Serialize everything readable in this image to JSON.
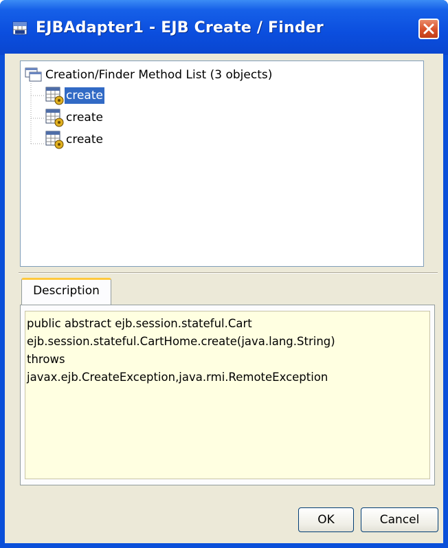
{
  "window": {
    "title": "EJBAdapter1 - EJB Create / Finder"
  },
  "tree": {
    "root_label": "Creation/Finder Method List (3 objects)",
    "items": [
      {
        "label": "create",
        "selected": true
      },
      {
        "label": "create",
        "selected": false
      },
      {
        "label": "create",
        "selected": false
      }
    ]
  },
  "description": {
    "tab_label": "Description",
    "lines": [
      "public abstract ejb.session.stateful.Cart",
      "ejb.session.stateful.CartHome.create(java.lang.String)",
      "throws",
      "javax.ejb.CreateException,java.rmi.RemoteException"
    ]
  },
  "buttons": {
    "ok_label": "OK",
    "cancel_label": "Cancel"
  },
  "colors": {
    "titlebar": "#0b4ede",
    "selection": "#316ac5",
    "description_background": "#ffffe1",
    "close_button": "#d8502a"
  },
  "icons": {
    "app": "ejb-icon",
    "close": "close-icon",
    "root": "windows-stack-icon",
    "item": "method-gear-icon"
  }
}
